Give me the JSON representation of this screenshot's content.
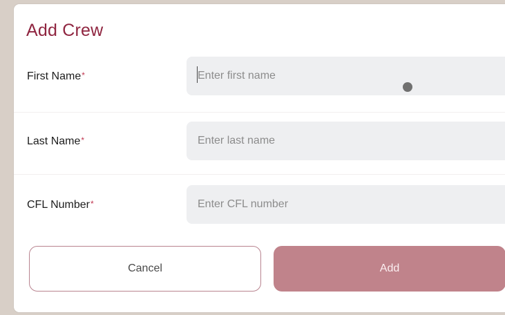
{
  "dialog": {
    "title": "Add Crew"
  },
  "fields": [
    {
      "label": "First Name",
      "required_mark": "*",
      "placeholder": "Enter first name",
      "value": ""
    },
    {
      "label": "Last Name",
      "required_mark": "*",
      "placeholder": "Enter last name",
      "value": ""
    },
    {
      "label": "CFL Number",
      "required_mark": "*",
      "placeholder": "Enter CFL number",
      "value": ""
    }
  ],
  "actions": {
    "cancel_label": "Cancel",
    "add_label": "Add"
  },
  "colors": {
    "title": "#8f2540",
    "required": "#c0364f",
    "add_button": "#c0838b",
    "cancel_border": "#b8838f",
    "input_bg": "#eeeff1",
    "backdrop": "#d8cfc7"
  }
}
